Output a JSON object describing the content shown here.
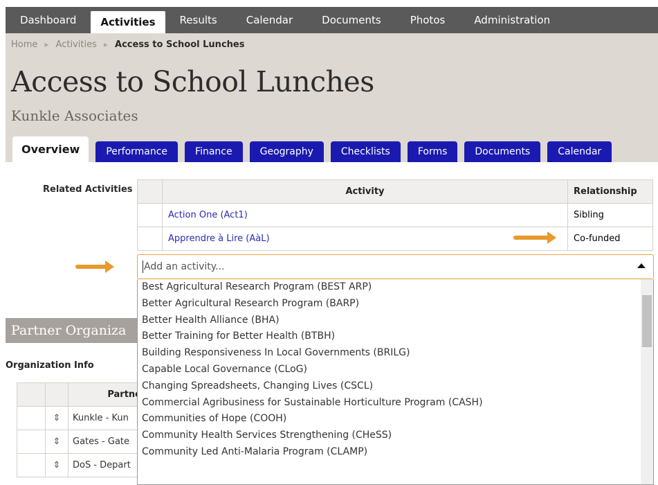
{
  "nav": {
    "items": [
      "Dashboard",
      "Activities",
      "Results",
      "Calendar",
      "Documents",
      "Photos",
      "Administration"
    ],
    "active": "Activities"
  },
  "breadcrumb": {
    "home": "Home",
    "activities": "Activities",
    "current": "Access to School Lunches"
  },
  "page": {
    "title": "Access to School Lunches",
    "subtitle": "Kunkle Associates"
  },
  "tabs": [
    "Overview",
    "Performance",
    "Finance",
    "Geography",
    "Checklists",
    "Forms",
    "Documents",
    "Calendar"
  ],
  "related": {
    "label": "Related Activities",
    "col_activity": "Activity",
    "col_relationship": "Relationship",
    "rows": [
      {
        "activity": "Action One (Act1)",
        "relationship": "Sibling"
      },
      {
        "activity": "Apprendre à Lire (AàL)",
        "relationship": "Co-funded"
      }
    ]
  },
  "add_activity": {
    "placeholder": "Add an activity..."
  },
  "dropdown_options": [
    "Best Agricultural Research Program (BEST ARP)",
    "Better Agricultural Research Program (BARP)",
    "Better Health Alliance (BHA)",
    "Better Training for Better Health (BTBH)",
    "Building Responsiveness In Local Governments (BRILG)",
    "Capable Local Governance (CLoG)",
    "Changing Spreadsheets, Changing Lives (CSCL)",
    "Commercial Agribusiness for Sustainable Horticulture Program (CASH)",
    "Communities of Hope (COOH)",
    "Community Health Services Strengthening (CHeSS)",
    "Community Led Anti-Malaria Program (CLAMP)"
  ],
  "partner": {
    "title": "Partner Organiza",
    "org_info_label": "Organization Info",
    "col_partner": "Partne",
    "rows": [
      "Kunkle - Kun",
      "Gates - Gate",
      "DoS - Depart"
    ]
  },
  "colors": {
    "nav_bg": "#5a5a5a",
    "header_bg": "#ded8d2",
    "tab_blue": "#1a1ab0",
    "link": "#2a2ab8",
    "accent_orange": "#e89a2c"
  },
  "icons": {
    "breadcrumb_separator": "triangle-right-icon",
    "sort_handle": "up-down-arrow-icon",
    "dropdown_toggle": "triangle-up-icon"
  }
}
